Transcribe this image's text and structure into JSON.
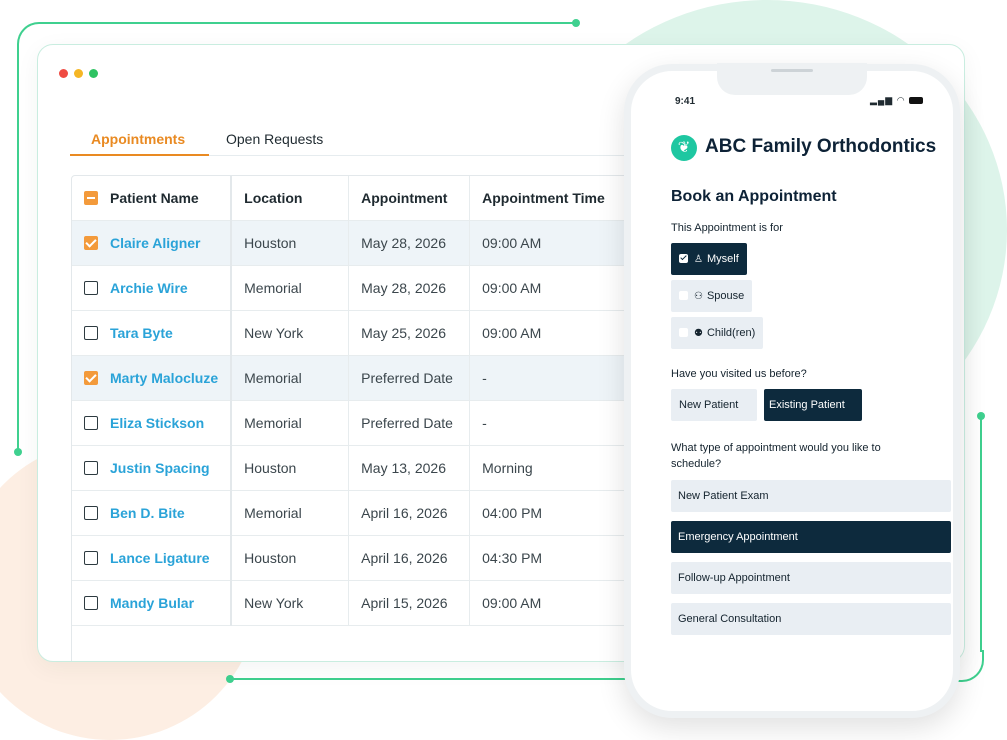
{
  "tabs": [
    {
      "label": "Appointments",
      "active": true
    },
    {
      "label": "Open Requests",
      "active": false
    }
  ],
  "table": {
    "headers": [
      "Patient Name",
      "Location",
      "Appointment",
      "Appointment Time"
    ],
    "rows": [
      {
        "name": "Claire Aligner",
        "location": "Houston",
        "appointment": "May 28, 2026",
        "time": "09:00 AM",
        "checked": true
      },
      {
        "name": "Archie Wire",
        "location": "Memorial",
        "appointment": "May 28, 2026",
        "time": "09:00 AM",
        "checked": false
      },
      {
        "name": "Tara Byte",
        "location": "New York",
        "appointment": "May 25, 2026",
        "time": "09:00 AM",
        "checked": false
      },
      {
        "name": "Marty Malocluze",
        "location": "Memorial",
        "appointment": "Preferred Date",
        "time": "-",
        "checked": true
      },
      {
        "name": "Eliza Stickson",
        "location": "Memorial",
        "appointment": "Preferred Date",
        "time": "-",
        "checked": false
      },
      {
        "name": "Justin Spacing",
        "location": "Houston",
        "appointment": "May 13, 2026",
        "time": "Morning",
        "checked": false
      },
      {
        "name": "Ben D. Bite",
        "location": "Memorial",
        "appointment": "April 16, 2026",
        "time": "04:00 PM",
        "checked": false
      },
      {
        "name": "Lance Ligature",
        "location": "Houston",
        "appointment": "April 16, 2026",
        "time": "04:30 PM",
        "checked": false
      },
      {
        "name": "Mandy Bular",
        "location": "New York",
        "appointment": "April 15, 2026",
        "time": "09:00 AM",
        "checked": false
      }
    ]
  },
  "phone": {
    "time": "9:41",
    "brand": "ABC Family Orthodontics",
    "form_title": "Book an Appointment",
    "q1": "This Appointment is for",
    "q1_options": [
      {
        "label": "Myself",
        "selected": true,
        "icon": "person-icon"
      },
      {
        "label": "Spouse",
        "selected": false,
        "icon": "people-icon"
      },
      {
        "label": "Child(ren)",
        "selected": false,
        "icon": "family-icon"
      }
    ],
    "q2": "Have you visited us before?",
    "q2_options": [
      {
        "label": "New Patient",
        "selected": false
      },
      {
        "label": "Existing Patient",
        "selected": true
      }
    ],
    "q3": "What type of appointment would you like to schedule?",
    "q3_options": [
      {
        "label": "New Patient Exam",
        "selected": false
      },
      {
        "label": "Emergency Appointment",
        "selected": true
      },
      {
        "label": "Follow-up Appointment",
        "selected": false
      },
      {
        "label": "General Consultation",
        "selected": false
      }
    ]
  },
  "colors": {
    "accent_orange": "#e98a22",
    "link_blue": "#2aa3d8",
    "brand_navy": "#0d2a3d",
    "brand_green": "#3fd08f"
  }
}
